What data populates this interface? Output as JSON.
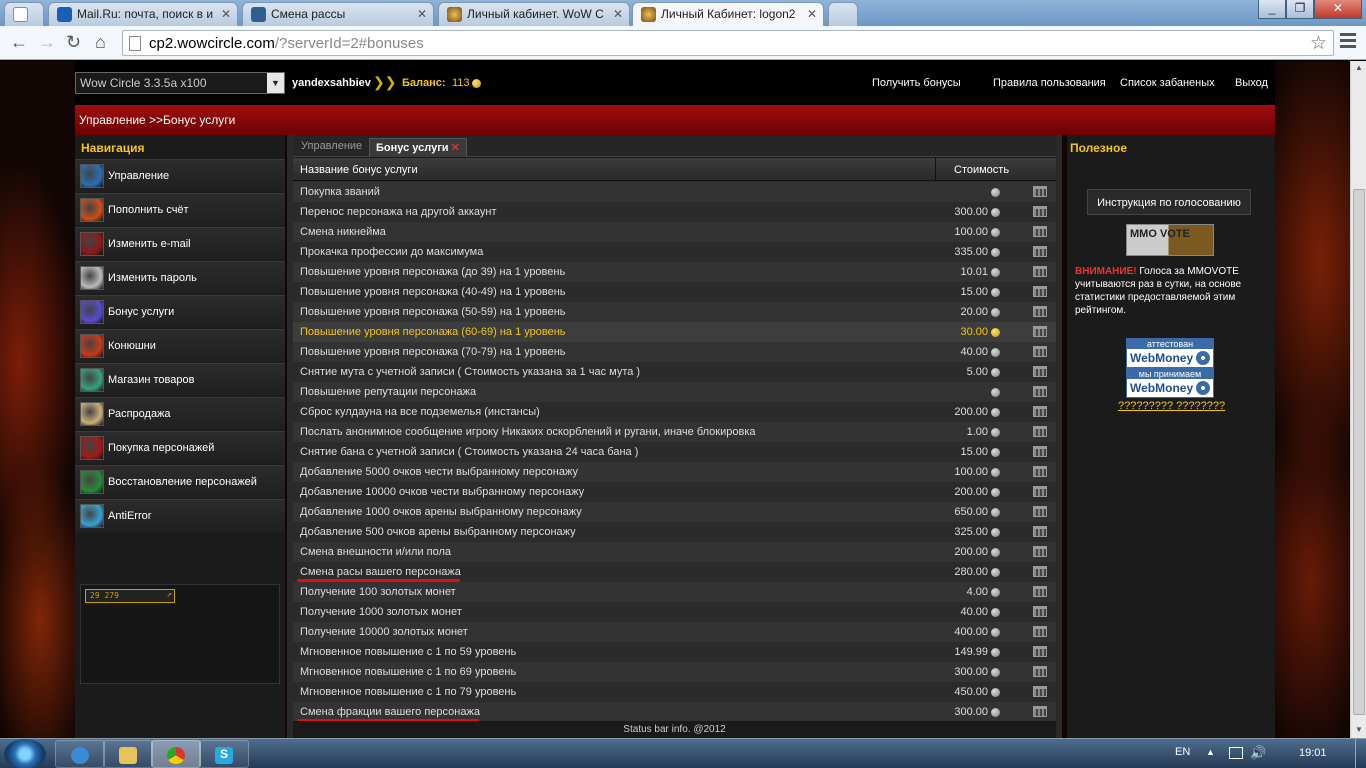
{
  "browser": {
    "tabs": [
      {
        "label": "",
        "favicon": "generic-icon"
      },
      {
        "label": "Mail.Ru: почта, поиск в и",
        "favicon": "mailru-icon"
      },
      {
        "label": "Смена рассы",
        "favicon": "generic-icon"
      },
      {
        "label": "Личный кабинет. WoW С",
        "favicon": "wow-icon"
      },
      {
        "label": "Личный Кабинет: logon2",
        "favicon": "wow-icon"
      }
    ],
    "url_host": "cp2.wowcircle.com",
    "url_path": "/?serverId=2#bonuses"
  },
  "header": {
    "server": "Wow Circle 3.3.5a x100",
    "username": "yandexsahbiev",
    "balance_label": "Баланс:",
    "balance_value": "113",
    "links": [
      "Получить бонусы",
      "Правила пользования",
      "Список забаненых",
      "Выход"
    ]
  },
  "breadcrumb": "Управление >>Бонус услуги",
  "nav": {
    "title": "Навигация",
    "items": [
      {
        "label": "Управление",
        "color": "#2a6fb3"
      },
      {
        "label": "Пополнить счёт",
        "color": "#c8501a"
      },
      {
        "label": "Изменить e-mail",
        "color": "#8a1a1a"
      },
      {
        "label": "Изменить пароль",
        "color": "#bbbbbb"
      },
      {
        "label": "Бонус услуги",
        "color": "#5a4bd0"
      },
      {
        "label": "Конюшни",
        "color": "#c83a1a"
      },
      {
        "label": "Магазин товаров",
        "color": "#3aa07a"
      },
      {
        "label": "Распродажа",
        "color": "#c8b07a"
      },
      {
        "label": "Покупка персонажей",
        "color": "#a01a1a"
      },
      {
        "label": "Восстановление персонажей",
        "color": "#2a8a3a"
      },
      {
        "label": "AntiError",
        "color": "#3aa0d0"
      }
    ],
    "counter": "29 279"
  },
  "tabs": {
    "manage": "Управление",
    "bonus": "Бонус услуги"
  },
  "grid": {
    "col_name": "Название бонус услуги",
    "col_cost": "Стоимость",
    "rows": [
      {
        "name": "Покупка званий",
        "price": ""
      },
      {
        "name": "Перенос персонажа на другой аккаунт",
        "price": "300.00"
      },
      {
        "name": "Смена никнейма",
        "price": "100.00"
      },
      {
        "name": "Прокачка профессии до максимума",
        "price": "335.00"
      },
      {
        "name": "Повышение уровня персонажа (до 39) на 1 уровень",
        "price": "10.01"
      },
      {
        "name": "Повышение уровня персонажа (40-49) на 1 уровень",
        "price": "15.00"
      },
      {
        "name": "Повышение уровня персонажа (50-59) на 1 уровень",
        "price": "20.00"
      },
      {
        "name": "Повышение уровня персонажа (60-69) на 1 уровень",
        "price": "30.00"
      },
      {
        "name": "Повышение уровня персонажа (70-79) на 1 уровень",
        "price": "40.00"
      },
      {
        "name": "Снятие мута с учетной записи ( Стоимость указана за 1 час мута )",
        "price": "5.00"
      },
      {
        "name": "Повышение репутации персонажа",
        "price": ""
      },
      {
        "name": "Сброс кулдауна на все подземелья (инстансы)",
        "price": "200.00"
      },
      {
        "name": "Послать анонимное сообщение игроку Никаких оскорблений и ругани, иначе блокировка",
        "price": "1.00"
      },
      {
        "name": "Снятие бана с учетной записи ( Стоимость указана 24 часа бана )",
        "price": "15.00"
      },
      {
        "name": "Добавление 5000 очков чести выбранному персонажу",
        "price": "100.00"
      },
      {
        "name": "Добавление 10000 очков чести выбранному персонажу",
        "price": "200.00"
      },
      {
        "name": "Добавление 1000 очков арены выбранному персонажу",
        "price": "650.00"
      },
      {
        "name": "Добавление 500 очков арены выбранному персонажу",
        "price": "325.00"
      },
      {
        "name": "Смена внешности и/или пола",
        "price": "200.00"
      },
      {
        "name": "Смена расы вашего персонажа",
        "price": "280.00"
      },
      {
        "name": "Получение 100 золотых монет",
        "price": "4.00"
      },
      {
        "name": "Получение 1000 золотых монет",
        "price": "40.00"
      },
      {
        "name": "Получение 10000 золотых монет",
        "price": "400.00"
      },
      {
        "name": "Мгновенное повышение с 1 по 59 уровень",
        "price": "149.99"
      },
      {
        "name": "Мгновенное повышение с 1 по 69 уровень",
        "price": "300.00"
      },
      {
        "name": "Мгновенное повышение с 1 по 79 уровень",
        "price": "450.00"
      },
      {
        "name": "Смена фракции вашего персонажа",
        "price": "300.00"
      }
    ],
    "highlighted_row": 7,
    "underlined_rows": [
      19,
      26
    ],
    "status": "Status bar info. @2012"
  },
  "right": {
    "title": "Полезное",
    "vote_button": "Инструкция по голосованию",
    "mmovote_logo": "MMO VOTE",
    "warn": "ВНИМАНИЕ!",
    "notice": " Голоса за MMOVOTE учитываются раз в сутки, на основе статистики предоставляемой этим рейтингом.",
    "wm1_top": "аттестован",
    "wm2_top": "мы принимаем",
    "wm_brand": "WebMoney",
    "wm_link": "????????? ????????"
  },
  "taskbar": {
    "lang": "EN",
    "time": "19:01"
  },
  "colors": {
    "accent": "#f5c518",
    "crumb_red": "#a00e0e",
    "underline": "#e01010"
  }
}
